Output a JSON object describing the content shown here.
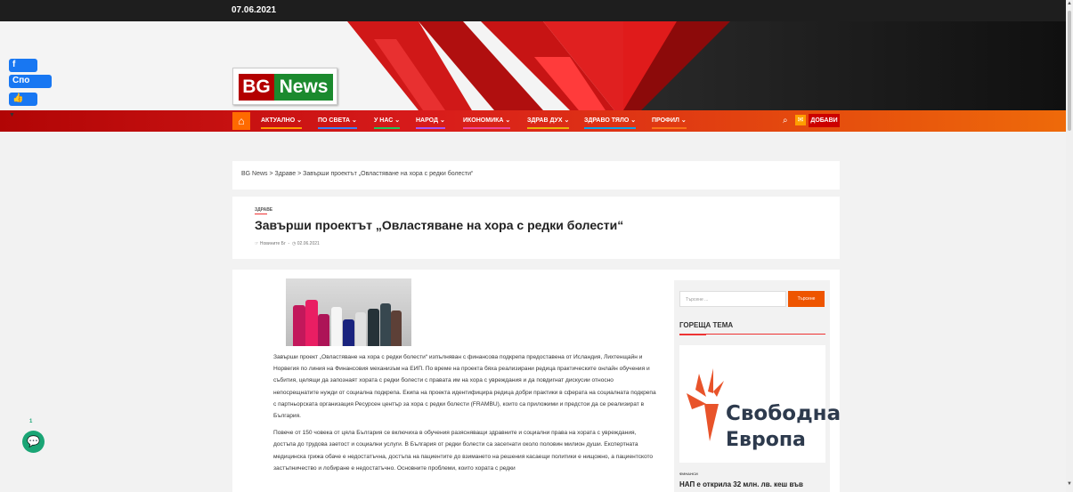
{
  "topbar": {
    "date": "07.06.2021"
  },
  "logo": {
    "part1": "BG",
    "part2": "News"
  },
  "social": [
    {
      "label": "f"
    },
    {
      "label": "Спо"
    },
    {
      "label": "👍"
    }
  ],
  "nav": {
    "items": [
      {
        "label": "АКТУАЛНО ⌄",
        "color": "#ff9c00"
      },
      {
        "label": "ПО СВЕТА ⌄",
        "color": "#3b82f6"
      },
      {
        "label": "У НАС ⌄",
        "color": "#22c55e"
      },
      {
        "label": "НАРОД ⌄",
        "color": "#a855f7"
      },
      {
        "label": "ИКОНОМИКА ⌄",
        "color": "#ec4899"
      },
      {
        "label": "ЗДРАВ ДУХ ⌄",
        "color": "#eab308"
      },
      {
        "label": "ЗДРАВО ТЯЛО ⌄",
        "color": "#0ea5e9"
      },
      {
        "label": "ПРОФИЛ ⌄",
        "color": "#f97316"
      }
    ],
    "add_label": "ДОБАВИ"
  },
  "breadcrumb": "BG News > Здраве > Завърши проектът „Овластяване на хора с редки болести“",
  "article": {
    "category": "ЗДРАВЕ",
    "title": "Завърши проектът „Овластяване на хора с редки болести“",
    "author": "☞ Новините Бг",
    "date": "◷ 02.06.2021",
    "paragraphs": [
      "Завърши проект „Овластяване на хора с редки болести“ изпълняван с финансова подкрепа предоставена от Исландия, Лихтенщайн и Норвегия по линия на Финансовия механизъм на ЕИП. По време на проекта бяха реализирани редица практическите онлайн обучения и събития, целящи да запознаят хората с редки болести с правата им на хора с увреждания и да повдигнат дискусии относно непосрещнатите нужди от социална подкрепа. Екипа на проекта идентифицира редица добри практики в сферата на социалната подкрепа с партньорската организация Ресурсен център за хора с редки болести (FRAMBU), които са приложими и предстои да се реализират в България.",
      "Повече от 150 човека от цяла България се включиха в обучения разясняващи здравните и социални права на хората с увреждания, достъпа до трудова заетост и социални услуги. В България от редки болести са засегнати около половин милион души. Експертната медицинска грижа обаче е недостатъчна, достъпа на пациентите до взимането на решения касаещи политики е нищожно, а пациентското застъпничество и лобиране е недостатъчно. Основните проблеми, които хората с редки"
    ]
  },
  "sidebar": {
    "search_placeholder": "Търсене ...",
    "search_button": "Търсене",
    "hot_topic": "ГОРЕЩА ТЕМА",
    "promo_line1": "Свободна",
    "promo_line2": "Европа",
    "next_category": "ФИНАНСИ",
    "next_title": "НАП е открила 32 млн. лв. кеш във"
  },
  "chat": {
    "count": "1"
  }
}
